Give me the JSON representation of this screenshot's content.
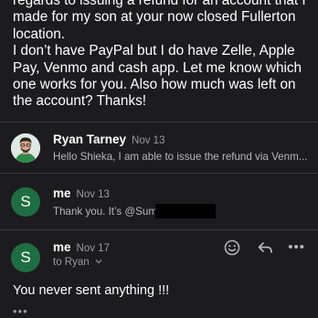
{
  "thread": {
    "body_paragraph_1": "regards to issuing a refund for an account that I made for my son at your now closed Fullerton location.",
    "body_paragraph_2": "I don’t have PayPal but I do have Zelle, Apple Pay, Venmo and cash app. Let me know which one works for you. Also how much was left on the account? Thanks!"
  },
  "messages": [
    {
      "sender": "Ryan Tarney",
      "date": "Nov 13",
      "preview": "Hello Shieka, I am able to issue the refund via Venm...",
      "avatar_icon": "person-photo"
    },
    {
      "sender": "me",
      "date": "Nov 13",
      "avatar_letter": "S",
      "preview": "Thank you. It’s @Sum"
    },
    {
      "sender": "me",
      "date": "Nov 17",
      "avatar_letter": "S",
      "to_label": "to Ryan",
      "body": "You never sent anything !!!"
    }
  ],
  "icons": {
    "more": "•••",
    "emoji": "smiley-icon",
    "reply": "reply-icon"
  },
  "colors": {
    "background": "#1c1c1e",
    "avatar_green": "#1f6e43",
    "secondary_text": "#9a9aa0"
  }
}
